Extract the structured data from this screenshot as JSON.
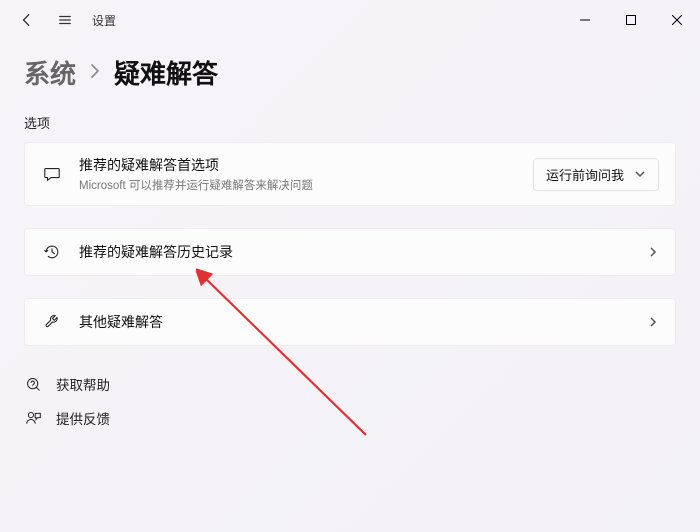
{
  "titlebar": {
    "app_name": "设置"
  },
  "breadcrumb": {
    "parent": "系统",
    "current": "疑难解答"
  },
  "section_label": "选项",
  "cards": {
    "recommended_prefs": {
      "title": "推荐的疑难解答首选项",
      "subtitle": "Microsoft 可以推荐并运行疑难解答来解决问题",
      "dropdown_value": "运行前询问我"
    },
    "history": {
      "title": "推荐的疑难解答历史记录"
    },
    "other": {
      "title": "其他疑难解答"
    }
  },
  "links": {
    "help": "获取帮助",
    "feedback": "提供反馈"
  }
}
